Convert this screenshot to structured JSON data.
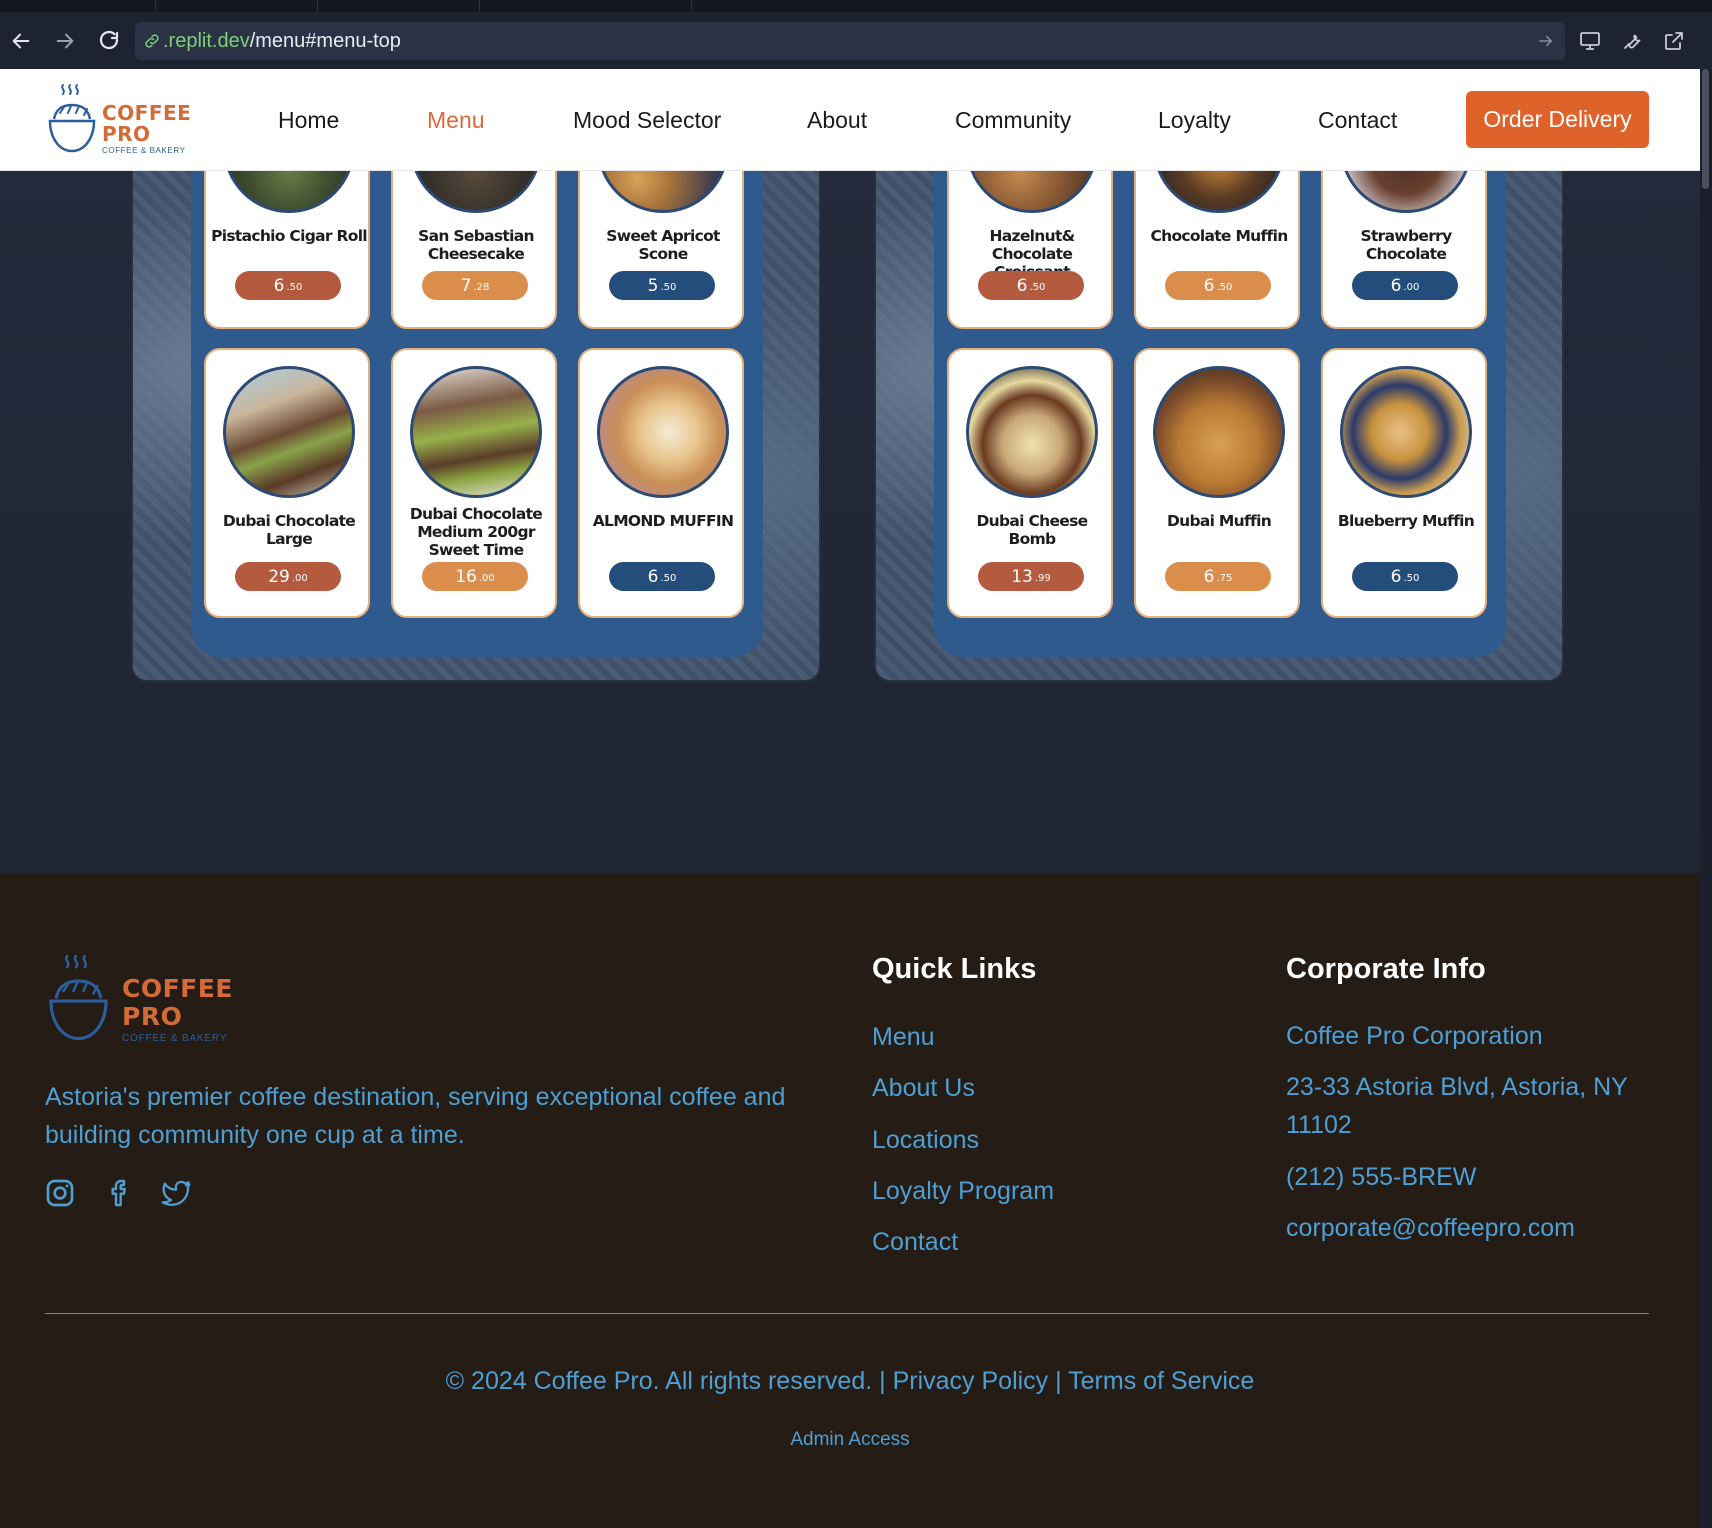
{
  "browser": {
    "url_host": ".replit.dev",
    "url_path": "/menu#menu-top"
  },
  "header": {
    "logo": {
      "line1": "COFFEE",
      "line2": "PRO",
      "tagline": "COFFEE & BAKERY"
    },
    "nav": [
      {
        "label": "Home",
        "active": false
      },
      {
        "label": "Menu",
        "active": true
      },
      {
        "label": "Mood Selector",
        "active": false
      },
      {
        "label": "About",
        "active": false
      },
      {
        "label": "Community",
        "active": false
      },
      {
        "label": "Loyalty",
        "active": false
      },
      {
        "label": "Contact",
        "active": false
      }
    ],
    "cta": "Order Delivery"
  },
  "menu_boards": [
    {
      "items": [
        {
          "name": "Pistachio Cigar Roll",
          "price_main": "6",
          "price_cents": ".50",
          "color": "#b45a3f"
        },
        {
          "name": "San Sebastian Cheesecake",
          "price_main": "7",
          "price_cents": ".28",
          "color": "#db8d4b"
        },
        {
          "name": "Sweet Apricot Scone",
          "price_main": "5",
          "price_cents": ".50",
          "color": "#254d7c"
        },
        {
          "name": "Dubai Chocolate Large",
          "price_main": "29",
          "price_cents": ".00",
          "color": "#b45a3f"
        },
        {
          "name": "Dubai Chocolate Medium 200gr Sweet Time",
          "price_main": "16",
          "price_cents": ".00",
          "color": "#db8d4b"
        },
        {
          "name": "ALMOND MUFFIN",
          "price_main": "6",
          "price_cents": ".50",
          "color": "#254d7c"
        }
      ]
    },
    {
      "items": [
        {
          "name": "Hazelnut& Chocolate Croissant",
          "price_main": "6",
          "price_cents": ".50",
          "color": "#b45a3f"
        },
        {
          "name": "Chocolate Muffin",
          "price_main": "6",
          "price_cents": ".50",
          "color": "#db8d4b"
        },
        {
          "name": "Strawberry Chocolate",
          "price_main": "6",
          "price_cents": ".00",
          "color": "#254d7c"
        },
        {
          "name": "Dubai Cheese Bomb",
          "price_main": "13",
          "price_cents": ".99",
          "color": "#b45a3f"
        },
        {
          "name": "Dubai Muffin",
          "price_main": "6",
          "price_cents": ".75",
          "color": "#db8d4b"
        },
        {
          "name": "Blueberry Muffin",
          "price_main": "6",
          "price_cents": ".50",
          "color": "#254d7c"
        }
      ]
    }
  ],
  "footer": {
    "logo": {
      "line1": "COFFEE",
      "line2": "PRO",
      "tagline": "COFFEE & BAKERY"
    },
    "description": "Astoria's premier coffee destination, serving exceptional coffee and building community one cup at a time.",
    "social": [
      "instagram-icon",
      "facebook-icon",
      "twitter-icon"
    ],
    "quick_links": {
      "title": "Quick Links",
      "links": [
        "Menu",
        "About Us",
        "Locations",
        "Loyalty Program",
        "Contact"
      ]
    },
    "corporate": {
      "title": "Corporate Info",
      "name": "Coffee Pro Corporation",
      "address": "23-33 Astoria Blvd, Astoria, NY 11102",
      "phone": "(212) 555-BREW",
      "email": "corporate@coffeepro.com"
    },
    "copyright": "© 2024 Coffee Pro. All rights reserved.",
    "privacy": "Privacy Policy",
    "terms": "Terms of Service",
    "separator": "|",
    "admin": "Admin Access"
  },
  "colors": {
    "accent": "#e0622b",
    "link": "#4d9fd4",
    "footer_bg": "#241c15",
    "panel": "#2e5a8e"
  }
}
